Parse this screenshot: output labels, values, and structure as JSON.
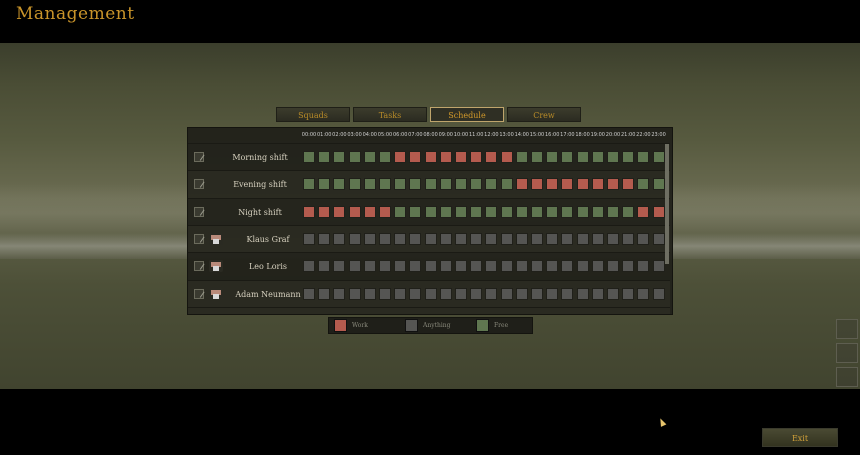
{
  "window": {
    "title": "Management"
  },
  "tabs": [
    {
      "label": "Squads",
      "active": false
    },
    {
      "label": "Tasks",
      "active": false
    },
    {
      "label": "Schedule",
      "active": true
    },
    {
      "label": "Crew",
      "active": false
    }
  ],
  "hours": [
    "00:00",
    "01:00",
    "02:00",
    "03:00",
    "04:00",
    "05:00",
    "06:00",
    "07:00",
    "08:00",
    "09:00",
    "10:00",
    "11:00",
    "12:00",
    "13:00",
    "14:00",
    "15:00",
    "16:00",
    "17:00",
    "18:00",
    "19:00",
    "20:00",
    "21:00",
    "22:00",
    "23:00"
  ],
  "colors": {
    "work": "#b45b4e",
    "anything": "#555553",
    "free": "#5f7650",
    "accent": "#c9942a"
  },
  "rows": [
    {
      "label": "Morning shift",
      "avatar": "",
      "cells": "FFFFFFWWWWWWWWFFFFFFFFFF"
    },
    {
      "label": "Evening shift",
      "avatar": "",
      "cells": "FFFFFFFFFFFFFFWWWWWWWWFF"
    },
    {
      "label": "Night shift",
      "avatar": "",
      "cells": "WWWWWWFFFFFFFFFFFFFFFFWW"
    },
    {
      "label": "Klaus Graf",
      "avatar": "soldier-avatar-icon",
      "cells": "AAAAAAAAAAAAAAAAAAAAAAAA"
    },
    {
      "label": "Leo Loris",
      "avatar": "soldier-avatar-icon",
      "cells": "AAAAAAAAAAAAAAAAAAAAAAAA"
    },
    {
      "label": "Adam Neumann",
      "avatar": "soldier-avatar-icon",
      "cells": "AAAAAAAAAAAAAAAAAAAAAAAA"
    }
  ],
  "legend": [
    {
      "key": "W",
      "label": "Work"
    },
    {
      "key": "A",
      "label": "Anything"
    },
    {
      "key": "F",
      "label": "Free"
    }
  ],
  "buttons": {
    "exit": "Exit"
  }
}
